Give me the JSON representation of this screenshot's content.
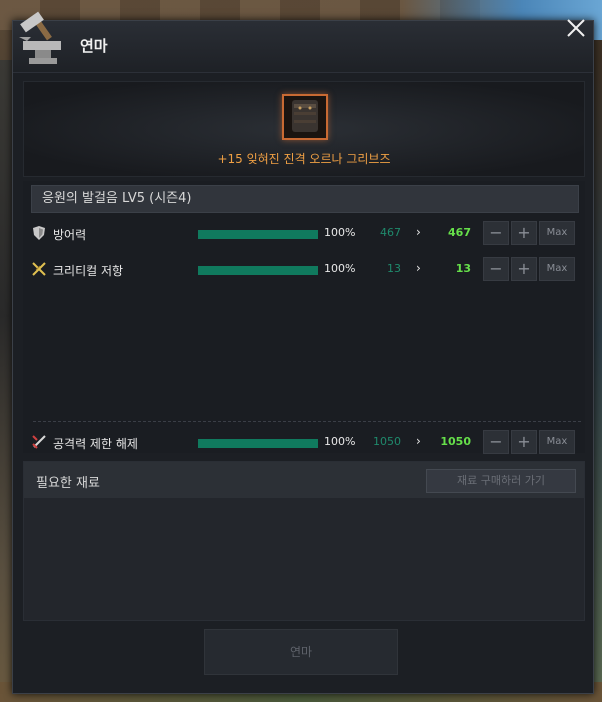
{
  "window": {
    "title": "연마"
  },
  "item": {
    "name": "+15 잊혀진 진격 오르나 그리브즈",
    "icon": "greaves-icon",
    "border_color": "#c86a33"
  },
  "stats_section": {
    "header": "응원의 발걸음 LV5 (시즌4)"
  },
  "stats": [
    {
      "icon": "shield-icon",
      "label": "방어력",
      "progress": "100%",
      "progress_fraction": 1.0,
      "old_value": "467",
      "arrow": "›",
      "new_value": "467",
      "minus": "−",
      "plus": "+",
      "max": "Max"
    },
    {
      "icon": "crossed-swords-icon",
      "label": "크리티컬 저항",
      "progress": "100%",
      "progress_fraction": 1.0,
      "old_value": "13",
      "arrow": "›",
      "new_value": "13",
      "minus": "−",
      "plus": "+",
      "max": "Max"
    }
  ],
  "special_stat": {
    "icon": "sword-icon",
    "label": "공격력 제한 해제",
    "progress": "100%",
    "progress_fraction": 1.0,
    "old_value": "1050",
    "arrow": "›",
    "new_value": "1050",
    "minus": "−",
    "plus": "+",
    "max": "Max"
  },
  "materials": {
    "title": "필요한 재료",
    "buy_button": "재료 구매하러 가기"
  },
  "action": {
    "button_label": "연마"
  },
  "colors": {
    "accent_green": "#107a5e",
    "new_value_green": "#66e04a",
    "item_name_orange": "#f0a044"
  }
}
